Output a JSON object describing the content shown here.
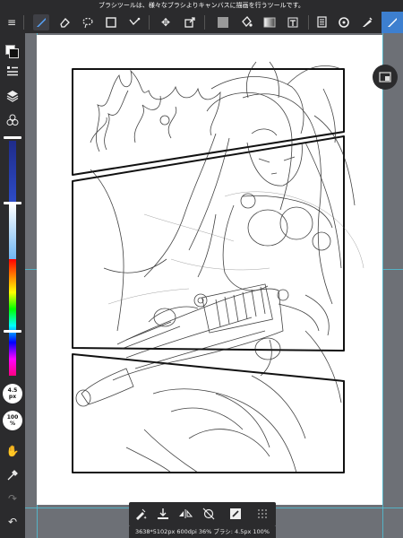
{
  "tooltip": "ブラシツールは、様々なブラシよりキャンバスに描画を行うツールです。",
  "toolbar": {
    "tools": [
      {
        "name": "menu-icon",
        "glyph": "≡"
      },
      {
        "name": "brush-icon",
        "glyph": "✎"
      },
      {
        "name": "eraser-icon",
        "glyph": "◪"
      },
      {
        "name": "lasso-icon",
        "glyph": "◌"
      },
      {
        "name": "rect-select-icon",
        "glyph": "▢"
      },
      {
        "name": "autoselect-icon",
        "glyph": "⋰"
      },
      {
        "name": "move-icon",
        "glyph": "✥"
      },
      {
        "name": "transform-icon",
        "glyph": "⤢"
      },
      {
        "name": "fill-color-icon",
        "glyph": "■"
      },
      {
        "name": "bucket-icon",
        "glyph": "⛋"
      },
      {
        "name": "gradient-icon",
        "glyph": "▤"
      },
      {
        "name": "text-icon",
        "glyph": "T"
      },
      {
        "name": "layers-panel-icon",
        "glyph": "▦"
      },
      {
        "name": "copy-layer-icon",
        "glyph": "⧉"
      },
      {
        "name": "rotate-icon",
        "glyph": "↻"
      },
      {
        "name": "settings-icon",
        "glyph": "⚙"
      },
      {
        "name": "blur-icon",
        "glyph": "◐"
      }
    ],
    "active_tool": "brush-icon"
  },
  "sidebar": {
    "brush_size": {
      "value": "4.5",
      "unit": "px"
    },
    "opacity": {
      "value": "100",
      "unit": "%"
    },
    "brush_size_level": 0.22,
    "opacity_level": 0.02
  },
  "bottom_bar": {
    "buttons": [
      "brush-settings-icon",
      "import-icon",
      "flip-icon",
      "snap-off-icon",
      "stabilizer-icon",
      "grid-icon"
    ]
  },
  "status": "3638*5102px 600dpi 36% ブラシ: 4.5px 100%"
}
